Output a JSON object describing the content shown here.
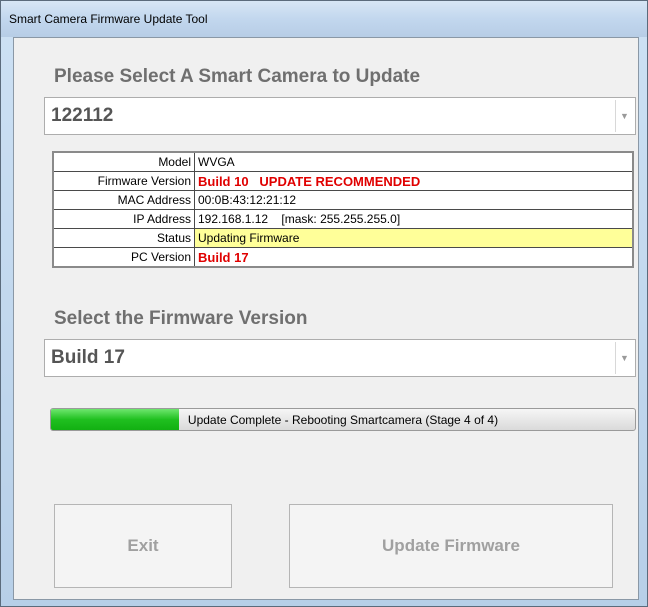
{
  "window": {
    "title": "Smart Camera Firmware Update Tool"
  },
  "camera_section": {
    "label": "Please Select A Smart Camera to Update",
    "selected": "122112"
  },
  "info_table": [
    {
      "label": "Model",
      "value": "WVGA",
      "style": "normal"
    },
    {
      "label": "Firmware Version",
      "value": "Build 10   UPDATE RECOMMENDED",
      "style": "red"
    },
    {
      "label": "MAC Address",
      "value": "00:0B:43:12:21:12",
      "style": "normal"
    },
    {
      "label": "IP Address",
      "value": "192.168.1.12    [mask: 255.255.255.0]",
      "style": "normal"
    },
    {
      "label": "Status",
      "value": "Updating Firmware",
      "style": "yellow"
    },
    {
      "label": "PC Version",
      "value": "Build 17",
      "style": "red"
    }
  ],
  "firmware_section": {
    "label": "Select the Firmware Version",
    "selected": "Build 17"
  },
  "progress": {
    "text": "Update Complete - Rebooting Smartcamera (Stage 4 of 4)",
    "fraction": 0.22,
    "color": "#20c020"
  },
  "buttons": {
    "exit_label": "Exit",
    "update_label": "Update Firmware"
  }
}
